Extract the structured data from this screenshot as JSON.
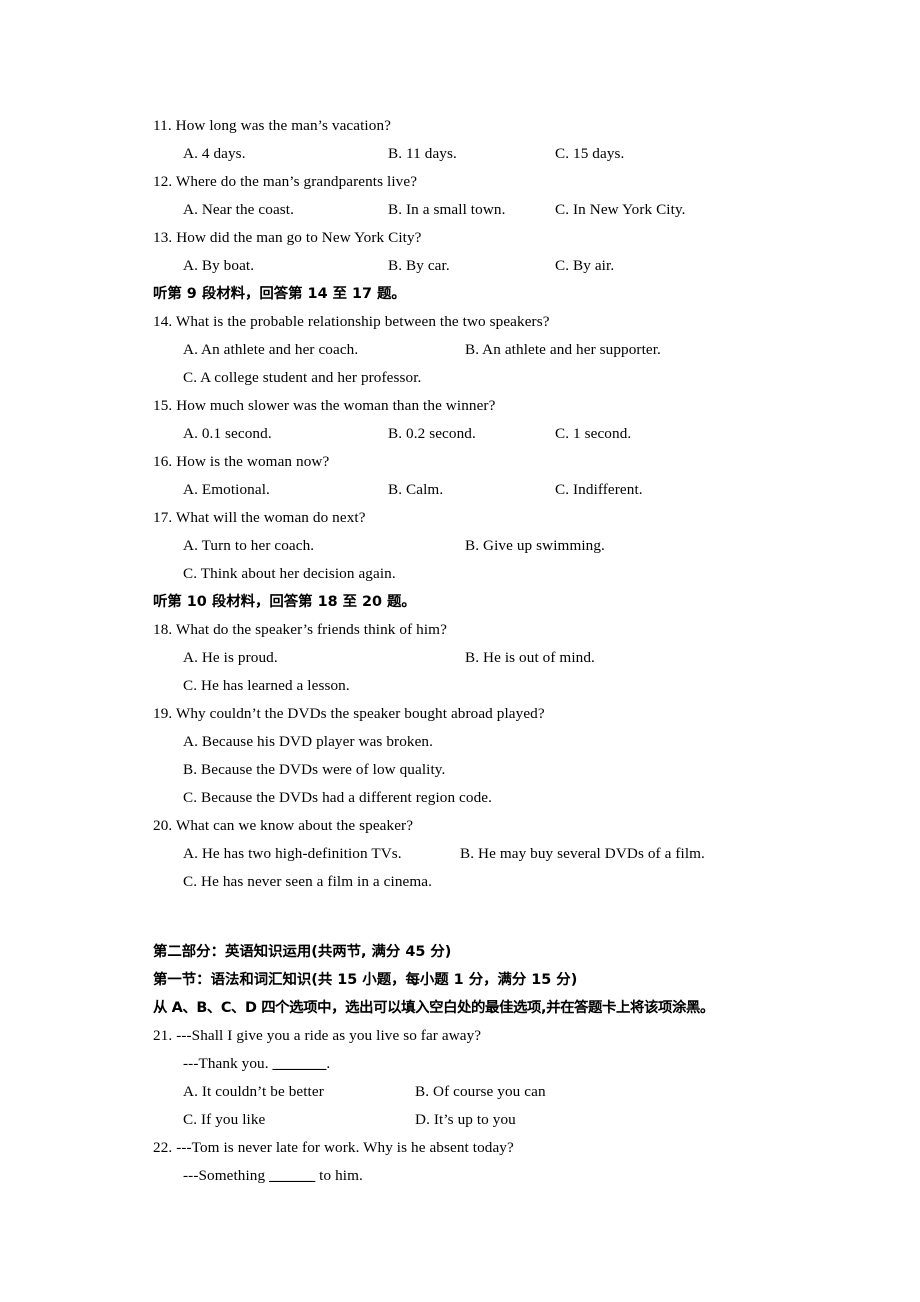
{
  "document": {
    "type": "english-exam-paper-page"
  },
  "listening": {
    "questions": [
      {
        "number": "11.",
        "stem": "How long was the man’s vacation?",
        "layout": "c3",
        "rows": [
          [
            "A. 4 days.",
            "B. 11 days.",
            "C. 15 days."
          ]
        ]
      },
      {
        "number": "12.",
        "stem": "Where do the man’s grandparents live?",
        "layout": "c3",
        "rows": [
          [
            "A. Near the coast.",
            "B. In a small town.",
            "C. In New York City."
          ]
        ]
      },
      {
        "number": "13.",
        "stem": "How did the man go to New York City?",
        "layout": "c3",
        "rows": [
          [
            "A. By boat.",
            "B. By car.",
            "C. By air."
          ]
        ]
      }
    ],
    "heading_9": "听第 9 段材料，回答第 14 至 17 题。",
    "questions_9": [
      {
        "number": "14.",
        "stem": "What is the probable relationship between the two speakers?",
        "layout": "c2",
        "rows": [
          [
            "A. An athlete and her coach.",
            "B. An athlete and her supporter."
          ],
          [
            "C. A college student and her professor."
          ]
        ]
      },
      {
        "number": "15.",
        "stem": "How much slower was the woman than the winner?",
        "layout": "c3",
        "rows": [
          [
            "A. 0.1 second.",
            "B. 0.2 second.",
            "C. 1 second."
          ]
        ]
      },
      {
        "number": "16.",
        "stem": "How is the woman now?",
        "layout": "c3",
        "rows": [
          [
            "A. Emotional.",
            "B. Calm.",
            "C. Indifferent."
          ]
        ]
      },
      {
        "number": "17.",
        "stem": "What will the woman do next?",
        "layout": "c2",
        "rows": [
          [
            "A. Turn to her coach.",
            "B. Give up swimming."
          ],
          [
            "C. Think about her decision again."
          ]
        ]
      }
    ],
    "heading_10": "听第 10 段材料，回答第 18 至 20 题。",
    "questions_10": [
      {
        "number": "18.",
        "stem": "What do the speaker’s friends think of him?",
        "layout": "c2",
        "rows": [
          [
            "A. He is proud.",
            "B. He is out of mind."
          ],
          [
            "C. He has learned a lesson."
          ]
        ]
      },
      {
        "number": "19.",
        "stem": "Why couldn’t the DVDs the speaker bought abroad played?",
        "layout": "c1",
        "rows": [
          [
            "A. Because his DVD player was broken."
          ],
          [
            "B. Because the DVDs were of low quality."
          ],
          [
            "C. Because the DVDs had a different region code."
          ]
        ]
      },
      {
        "number": "20.",
        "stem": "What can we know about the speaker?",
        "layout": "c2b",
        "rows": [
          [
            "A. He has two high-definition TVs.",
            "B. He may buy several DVDs of a film."
          ],
          [
            "C. He has never seen a film in a cinema."
          ]
        ]
      }
    ]
  },
  "part2": {
    "part_heading": "第二部分：英语知识运用(共两节, 满分 45 分)",
    "section_heading": "第一节：语法和词汇知识(共 15 小题，每小题 1 分，满分 15 分)",
    "instruction": "从 A、B、C、D 四个选项中，选出可以填入空白处的最佳选项,并在答题卡上将该项涂黑。",
    "questions": [
      {
        "number": "21.",
        "stem": "---Shall I give you a ride as you live so far away?",
        "stem2_pre": "---Thank you. ",
        "stem2_blank": "_______",
        "stem2_post": ".",
        "layout": "c2c",
        "rows": [
          [
            "A. It couldn’t be better",
            "B. Of course you can"
          ],
          [
            "C. If you like",
            "D. It’s up to you"
          ]
        ]
      },
      {
        "number": "22.",
        "stem": "---Tom is never late for work. Why is he absent today?",
        "stem2_pre": "---Something ",
        "stem2_blank": "______",
        "stem2_post": " to him.",
        "layout": "c2c",
        "rows": []
      }
    ]
  }
}
